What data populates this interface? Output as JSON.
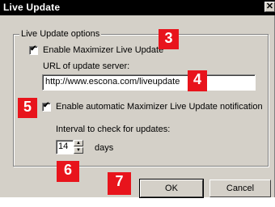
{
  "window": {
    "title": "Live Update",
    "close_glyph": "✕"
  },
  "group": {
    "legend": "Live Update options"
  },
  "enable_checkbox": {
    "label": "Enable Maximizer Live Update",
    "checked": true
  },
  "url": {
    "label": "URL of update server:",
    "value": "http://www.escona.com/liveupdate"
  },
  "notify_checkbox": {
    "label": "Enable automatic Maximizer Live Update notification",
    "checked": true
  },
  "interval": {
    "label": "Interval to check for updates:",
    "value": "14",
    "unit": "days"
  },
  "badges": [
    "3",
    "4",
    "5",
    "6",
    "7"
  ],
  "buttons": {
    "ok": "OK",
    "cancel": "Cancel"
  },
  "colors": {
    "badge": "#e8141c",
    "dialog_bg": "#d4d0c8"
  }
}
